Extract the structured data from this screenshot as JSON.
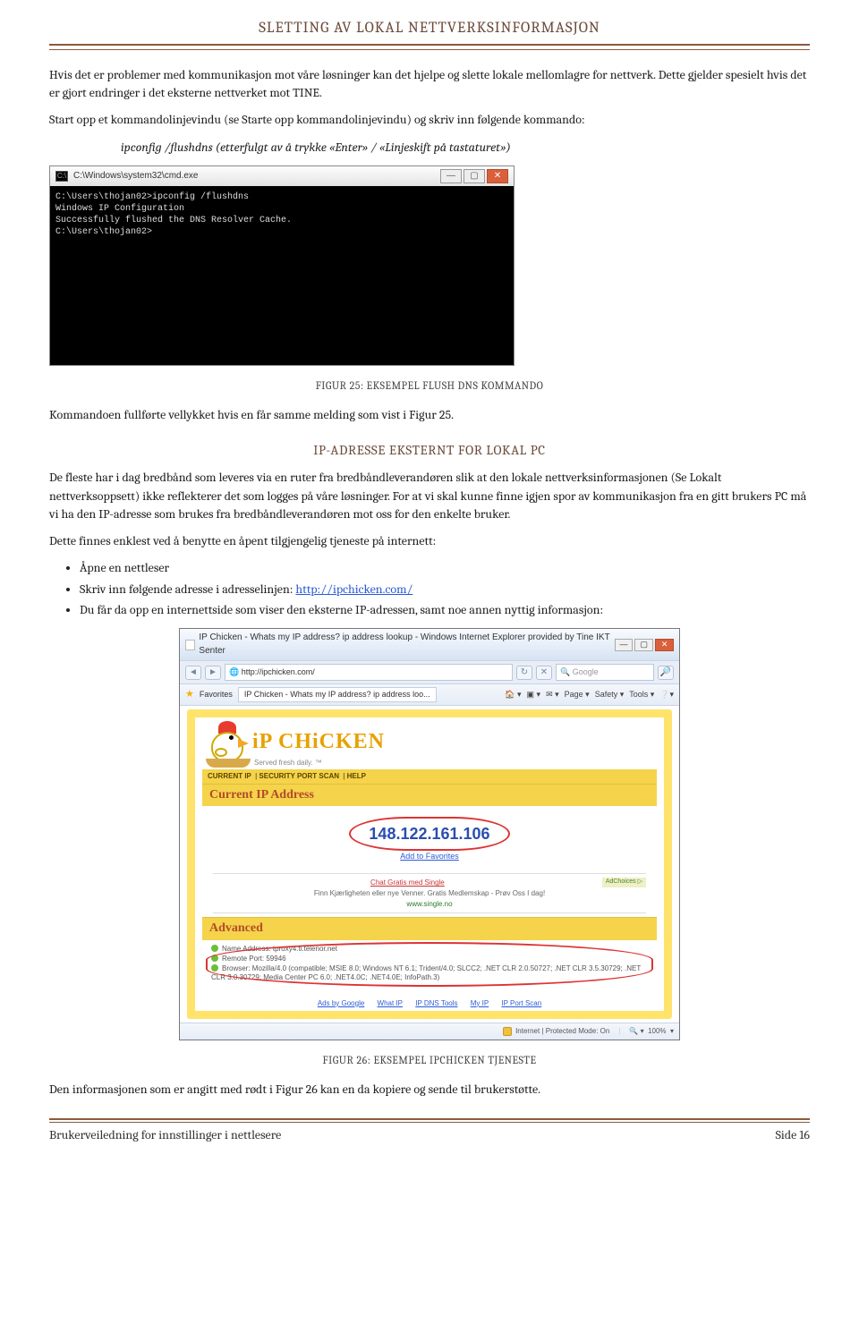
{
  "header": {
    "title": "SLETTING AV LOKAL NETTVERKSINFORMASJON"
  },
  "p1": "Hvis det er problemer med kommunikasjon mot våre løsninger kan det hjelpe og slette lokale mellomlagre for nettverk. Dette gjelder spesielt hvis det er gjort endringer i det eksterne nettverket mot TINE.",
  "p2": "Start opp et kommandolinjevindu (se Starte opp kommandolinjevindu) og skriv inn følgende kommando:",
  "p3": "ipconfig /flushdns (etterfulgt av å trykke «Enter» / «Linjeskift på tastaturet»)",
  "cmd": {
    "title": "C:\\Windows\\system32\\cmd.exe",
    "lines": "C:\\Users\\thojan02>ipconfig /flushdns\nWindows IP Configuration\nSuccessfully flushed the DNS Resolver Cache.\nC:\\Users\\thojan02>"
  },
  "caption1": "FIGUR 25: EKSEMPEL FLUSH DNS KOMMANDO",
  "p4": "Kommandoen fullførte vellykket hvis en får samme melding som vist i Figur 25.",
  "section2": "IP-ADRESSE EKSTERNT FOR LOKAL PC",
  "p5": "De fleste har i dag bredbånd som leveres via en ruter fra bredbåndleverandøren slik at den lokale nettverksinformasjonen (Se Lokalt nettverksoppsett) ikke reflekterer det som logges på våre løsninger. For at vi skal kunne finne igjen spor av kommunikasjon fra en gitt brukers PC må vi ha den IP-adresse som brukes fra bredbåndleverandøren mot oss for den enkelte bruker.",
  "p6": "Dette finnes enklest ved å benytte en åpent tilgjengelig tjeneste på internett:",
  "bullets": {
    "b1": "Åpne en nettleser",
    "b2a": "Skriv inn følgende adresse i adresselinjen: ",
    "b2link": "http://ipchicken.com/",
    "b3": "Du får da opp en internettside som viser den eksterne IP-adressen, samt noe annen nyttig informasjon:"
  },
  "ie": {
    "title": "IP Chicken - Whats my IP address? ip address lookup - Windows Internet Explorer provided by Tine IKT Senter",
    "url": "http://ipchicken.com/",
    "search": "Google",
    "fav": "Favorites",
    "tab": "IP Chicken - Whats my IP address? ip address loo...",
    "tools": {
      "home": "",
      "rss": "",
      "mail": "",
      "page": "Page ▾",
      "safety": "Safety ▾",
      "tools": "Tools ▾"
    },
    "status": "Internet | Protected Mode: On",
    "zoom": "100%"
  },
  "ipc": {
    "logo": "iP CHiCKEN",
    "served": "Served fresh daily. ™",
    "nav": {
      "a": "CURRENT IP",
      "b": "SECURITY PORT SCAN",
      "c": "HELP"
    },
    "section_current": "Current IP Address",
    "ip": "148.122.161.106",
    "addfav": "Add to Favorites",
    "ad_title": "Chat Gratis med Single",
    "ad_text": "Finn Kjærligheten eller nye Venner. Gratis Medlemskap - Prøv Oss I dag!",
    "ad_link": "www.single.no",
    "ad_chip": "AdChoices ▷",
    "section_adv": "Advanced",
    "adv1": "Name Address: tproxy4.ti.telenor.net",
    "adv2": "Remote Port: 59946",
    "adv3": "Browser: Mozilla/4.0 (compatible; MSIE 8.0; Windows NT 6.1; Trident/4.0; SLCC2; .NET CLR 2.0.50727; .NET CLR 3.5.30729; .NET CLR 3.0.30729; Media Center PC 6.0; .NET4.0C; .NET4.0E; InfoPath.3)",
    "links": {
      "a": "Ads by Google",
      "b": "What IP",
      "c": "IP DNS Tools",
      "d": "My IP",
      "e": "IP Port Scan"
    }
  },
  "caption2": "FIGUR 26: EKSEMPEL IPCHICKEN TJENESTE",
  "p7": "Den informasjonen som er angitt med rødt i Figur 26 kan en da kopiere og sende til brukerstøtte.",
  "footer": {
    "left": "Brukerveiledning for innstillinger i nettlesere",
    "right": "Side 16"
  }
}
